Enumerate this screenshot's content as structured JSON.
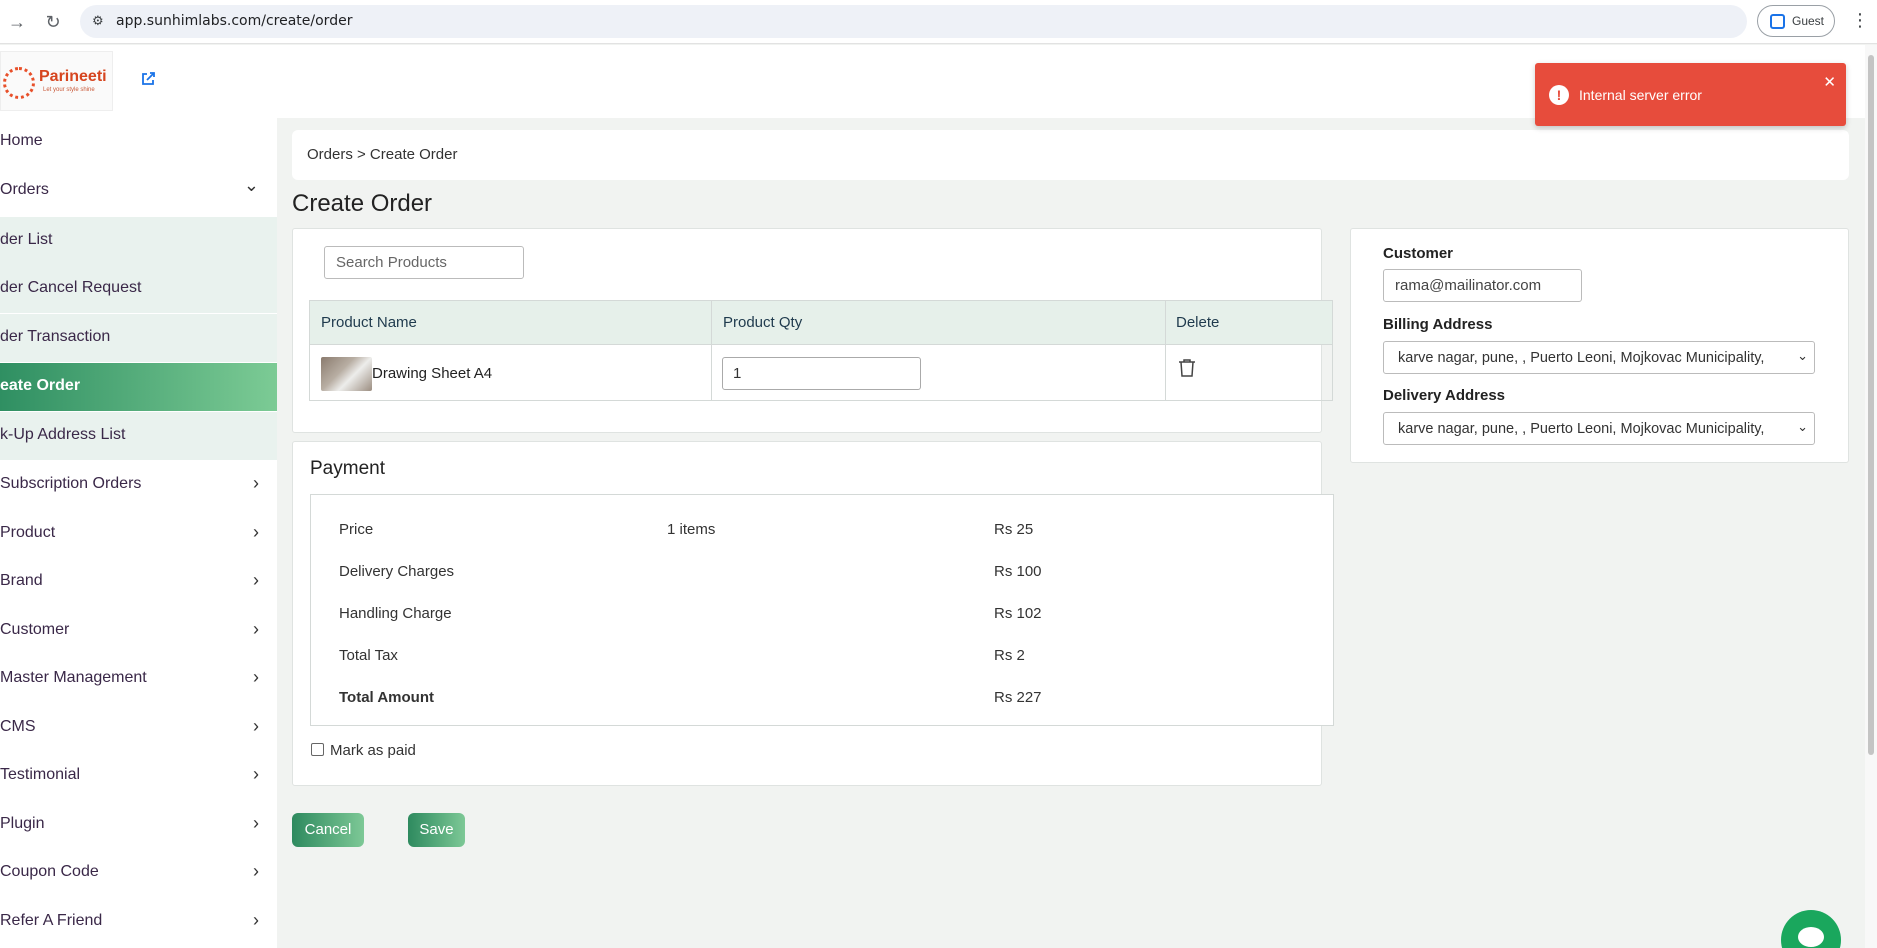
{
  "browser": {
    "url": "app.sunhimlabs.com/create/order",
    "profile_label": "Guest"
  },
  "brand": {
    "name": "Parineeti",
    "tagline": "Let your style shine"
  },
  "sidebar": {
    "items": [
      {
        "label": "Home",
        "expandable": false,
        "type": "top"
      },
      {
        "label": "Orders",
        "expandable": true,
        "expanded": true,
        "type": "top"
      },
      {
        "label": "der List",
        "type": "sub"
      },
      {
        "label": "der Cancel Request",
        "type": "sub"
      },
      {
        "label": "der Transaction",
        "type": "sub"
      },
      {
        "label": "eate Order",
        "type": "sub",
        "active": true
      },
      {
        "label": "k-Up Address List",
        "type": "sub"
      },
      {
        "label": "Subscription Orders",
        "expandable": true,
        "type": "top"
      },
      {
        "label": "Product",
        "expandable": true,
        "type": "top"
      },
      {
        "label": "Brand",
        "expandable": true,
        "type": "top"
      },
      {
        "label": "Customer",
        "expandable": true,
        "type": "top"
      },
      {
        "label": " Master Management",
        "expandable": true,
        "type": "top"
      },
      {
        "label": "CMS",
        "expandable": true,
        "type": "top"
      },
      {
        "label": "Testimonial",
        "expandable": true,
        "type": "top"
      },
      {
        "label": "Plugin",
        "expandable": true,
        "type": "top"
      },
      {
        "label": "Coupon Code",
        "expandable": true,
        "type": "top"
      },
      {
        "label": " Refer A Friend",
        "expandable": true,
        "type": "top"
      }
    ]
  },
  "breadcrumb": "Orders > Create Order",
  "page_title": "Create Order",
  "products": {
    "search_placeholder": "Search Products",
    "columns": [
      "Product Name",
      "Product Qty",
      "Delete"
    ],
    "rows": [
      {
        "name": "Drawing Sheet A4",
        "qty": "1"
      }
    ]
  },
  "payment": {
    "title": "Payment",
    "rows": [
      {
        "label": "Price",
        "detail": "1 items",
        "amount": "Rs 25"
      },
      {
        "label": "Delivery Charges",
        "detail": "",
        "amount": "Rs 100"
      },
      {
        "label": "Handling Charge",
        "detail": "",
        "amount": "Rs 102"
      },
      {
        "label": "Total Tax",
        "detail": "",
        "amount": "Rs 2"
      },
      {
        "label": "Total Amount",
        "detail": "",
        "amount": "Rs 227"
      }
    ],
    "mark_as_paid_label": "Mark as paid",
    "mark_as_paid_checked": false
  },
  "actions": {
    "cancel_label": "Cancel",
    "save_label": "Save"
  },
  "customer_panel": {
    "customer_label": "Customer",
    "customer_value": "rama@mailinator.com",
    "billing_label": "Billing Address",
    "billing_value": "karve nagar, pune, , Puerto Leoni, Mojkovac Municipality,",
    "delivery_label": "Delivery Address",
    "delivery_value": "karve nagar, pune, , Puerto Leoni, Mojkovac Municipality,"
  },
  "toast": {
    "message": "Internal server error",
    "type": "error",
    "color": "#e74c3c"
  },
  "colors": {
    "accent_start": "#2e8a5f",
    "accent_end": "#7dc896",
    "sidebar_sub_bg": "#e9f2ee"
  }
}
